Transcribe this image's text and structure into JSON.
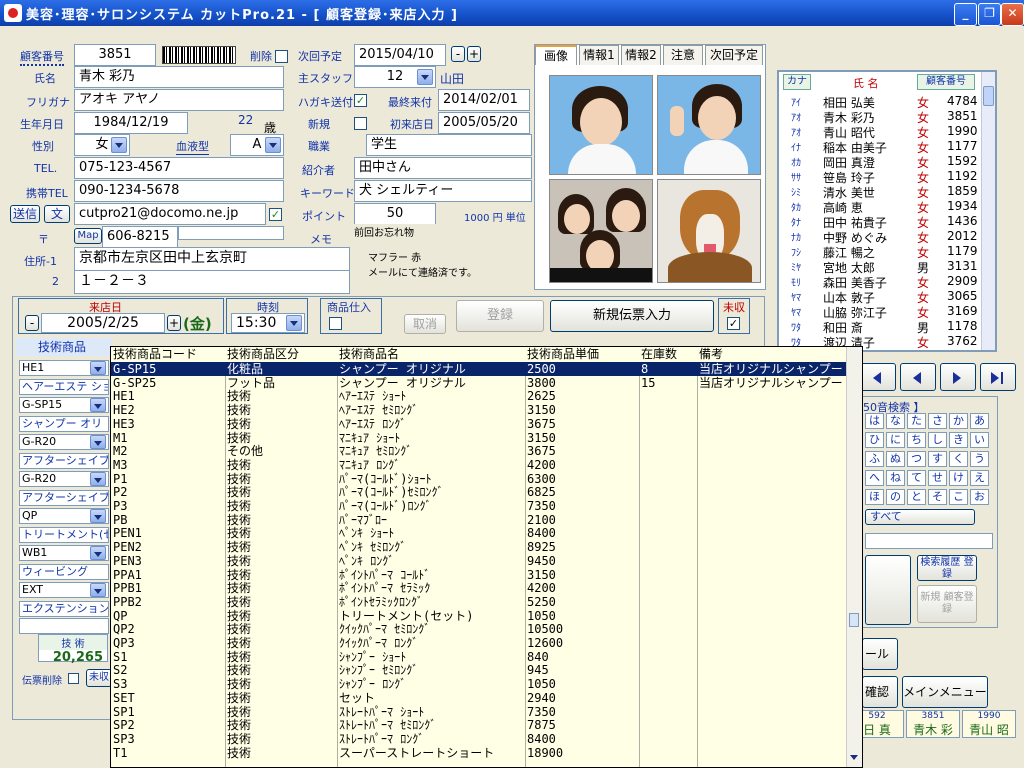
{
  "window": {
    "title": "美容･理容･サロンシステム カットPro.21 - [ 顧客登録･来店入力 ]"
  },
  "customer": {
    "no_label": "顧客番号",
    "no": "3851",
    "delete_label": "削除",
    "name_label": "氏名",
    "name": "青木 彩乃",
    "furigana_label": "フリガナ",
    "furigana": "アオキ アヤノ",
    "birth_label": "生年月日",
    "birth": "1984/12/19",
    "age": "22",
    "age_unit": "歳",
    "sex_label": "性別",
    "sex": "女",
    "blood_label": "血液型",
    "blood": "A",
    "tel_label": "TEL.",
    "tel": "075-123-4567",
    "mobile_label": "携帯TEL",
    "mobile": "090-1234-5678",
    "send_label": "送信",
    "text_label": "文",
    "email": "cutpro21@docomo.ne.jp",
    "zip_label": "〒",
    "map_label": "Map",
    "zip": "606-8215",
    "addr1_label": "住所-1",
    "addr1": "京都市左京区田中上玄京町",
    "addr2_label": "2",
    "addr2": "１－２－３",
    "next_label": "次回予定",
    "next": "2015/04/10",
    "staff_label": "主スタッフ",
    "staff_no": "12",
    "staff_name": "山田",
    "postcard_label": "ハガキ送付",
    "last_visit_label": "最終来付",
    "last_visit": "2014/02/01",
    "new_label": "新規",
    "first_visit_label": "初来店日",
    "first_visit": "2005/05/20",
    "job_label": "職業",
    "job": "学生",
    "referrer_label": "紹介者",
    "referrer": "田中さん",
    "keyword_label": "キーワード",
    "keyword": "犬 シェルティー",
    "point_label": "ポイント",
    "point": "50",
    "point_unit": "1000 円 単位",
    "memo_label": "メモ",
    "memo_title": "前回お忘れ物",
    "memo_line1": "マフラー 赤",
    "memo_line2": "メールにて連絡済です。"
  },
  "tabs": [
    "画像",
    "情報1",
    "情報2",
    "注意",
    "次回予定"
  ],
  "custlist": {
    "header_kana": "カナ",
    "header_name": "氏 名",
    "header_no": "顧客番号",
    "rows": [
      [
        "ｱｲ",
        "相田 弘美",
        "女",
        "4784"
      ],
      [
        "ｱｵ",
        "青木 彩乃",
        "女",
        "3851"
      ],
      [
        "ｱｵ",
        "青山 昭代",
        "女",
        "1990"
      ],
      [
        "ｲﾅ",
        "稲本 由美子",
        "女",
        "1177"
      ],
      [
        "ｵｶ",
        "岡田 真澄",
        "女",
        "1592"
      ],
      [
        "ｻｻ",
        "笹島 玲子",
        "女",
        "1192"
      ],
      [
        "ｼﾐ",
        "清水 美世",
        "女",
        "1859"
      ],
      [
        "ﾀｶ",
        "高崎 恵",
        "女",
        "1934"
      ],
      [
        "ﾀﾅ",
        "田中 祐貴子",
        "女",
        "1436"
      ],
      [
        "ﾅｶ",
        "中野 めぐみ",
        "女",
        "2012"
      ],
      [
        "ﾌｼ",
        "藤江 暢之",
        "女",
        "1179"
      ],
      [
        "ﾐﾔ",
        "宮地 太郎",
        "男",
        "3131"
      ],
      [
        "ﾓﾘ",
        "森田 美香子",
        "女",
        "2909"
      ],
      [
        "ﾔﾏ",
        "山本 敦子",
        "女",
        "3065"
      ],
      [
        "ﾔﾏ",
        "山脇 弥江子",
        "女",
        "3169"
      ],
      [
        "ﾜﾀ",
        "和田 斎",
        "男",
        "1178"
      ],
      [
        "ﾜﾀ",
        "渡辺 清子",
        "女",
        "3762"
      ]
    ]
  },
  "visit": {
    "date_label": "来店日",
    "date": "2005/2/25",
    "weekday": "(金)",
    "time_label": "時刻",
    "time": "15:30",
    "goods_label": "商品仕入",
    "cancel_label": "取消",
    "register_label": "登録",
    "new_slip_label": "新規伝票入力",
    "unpaid_label": "未収",
    "tech_header": "技術商品",
    "tech_total_label": "技 術",
    "tech_total": "20,265",
    "slip_delete_label": "伝票削除",
    "unpaid_btn": "未収"
  },
  "techlist": [
    "HE1",
    "ヘアーエステ ショート",
    "G-SP15",
    "シャンプー オリ",
    "G-R20",
    "アフターシェイブ",
    "G-R20",
    "アフターシェイブ",
    "QP",
    "トリートメント(セ",
    "WB1",
    "ウィービング",
    "EXT",
    "エクステンション"
  ],
  "kana_search": {
    "title": "50音検索 】",
    "chars": [
      [
        "は",
        "な",
        "た",
        "さ",
        "か",
        "あ"
      ],
      [
        "ひ",
        "に",
        "ち",
        "し",
        "き",
        "い"
      ],
      [
        "ふ",
        "ぬ",
        "つ",
        "す",
        "く",
        "う"
      ],
      [
        "へ",
        "ね",
        "て",
        "せ",
        "け",
        "え"
      ],
      [
        "ほ",
        "の",
        "と",
        "そ",
        "こ",
        "お"
      ]
    ],
    "all_label": "すべて",
    "history_label": "検索履歴 登録",
    "new_customer_label": "新規 顧客登録",
    "mail_label": "ール",
    "confirm_label": "確認",
    "main_menu_label": "メインメニュー"
  },
  "mini_cards": [
    [
      "592",
      "日 真"
    ],
    [
      "3851",
      "青木 彩"
    ],
    [
      "1990",
      "青山 昭"
    ]
  ],
  "dropdown": {
    "headers": [
      "技術商品コード",
      "技術商品区分",
      "技術商品名",
      "技術商品単価",
      "在庫数",
      "備考"
    ],
    "rows": [
      [
        "G-SP15",
        "化粧品",
        "シャンプー オリジナル",
        "2500",
        "8",
        "当店オリジナルシャンプー"
      ],
      [
        "G-SP25",
        "フット品",
        "シャンプー オリジナル",
        "3800",
        "15",
        "当店オリジナルシャンプー"
      ],
      [
        "HE1",
        "技術",
        "ﾍｱｰｴｽﾃ ｼｮｰﾄ",
        "2625",
        "",
        ""
      ],
      [
        "HE2",
        "技術",
        "ﾍｱｰｴｽﾃ ｾﾐﾛﾝｸﾞ",
        "3150",
        "",
        ""
      ],
      [
        "HE3",
        "技術",
        "ﾍｱｰｴｽﾃ ﾛﾝｸﾞ",
        "3675",
        "",
        ""
      ],
      [
        "M1",
        "技術",
        "ﾏﾆｷｭｱ ｼｮｰﾄ",
        "3150",
        "",
        ""
      ],
      [
        "M2",
        "その他",
        "ﾏﾆｷｭｱ ｾﾐﾛﾝｸﾞ",
        "3675",
        "",
        ""
      ],
      [
        "M3",
        "技術",
        "ﾏﾆｷｭｱ ﾛﾝｸﾞ",
        "4200",
        "",
        ""
      ],
      [
        "P1",
        "技術",
        "ﾊﾟｰﾏ(ｺｰﾙﾄﾞ)ｼｮｰﾄ",
        "6300",
        "",
        ""
      ],
      [
        "P2",
        "技術",
        "ﾊﾟｰﾏ(ｺｰﾙﾄﾞ)ｾﾐﾛﾝｸﾞ",
        "6825",
        "",
        ""
      ],
      [
        "P3",
        "技術",
        "ﾊﾟｰﾏ(ｺｰﾙﾄﾞ)ﾛﾝｸﾞ",
        "7350",
        "",
        ""
      ],
      [
        "PB",
        "技術",
        "ﾊﾟｰﾏﾌﾞﾛｰ",
        "2100",
        "",
        ""
      ],
      [
        "PEN1",
        "技術",
        "ﾍﾟﾝｷ ｼｮｰﾄ",
        "8400",
        "",
        ""
      ],
      [
        "PEN2",
        "技術",
        "ﾍﾟﾝｷ ｾﾐﾛﾝｸﾞ",
        "8925",
        "",
        ""
      ],
      [
        "PEN3",
        "技術",
        "ﾍﾟﾝｷ ﾛﾝｸﾞ",
        "9450",
        "",
        ""
      ],
      [
        "PPA1",
        "技術",
        "ﾎﾟｲﾝﾄﾊﾟｰﾏ ｺｰﾙﾄﾞ",
        "3150",
        "",
        ""
      ],
      [
        "PPB1",
        "技術",
        "ﾎﾟｲﾝﾄﾊﾟｰﾏ ｾﾗﾐｯｸ",
        "4200",
        "",
        ""
      ],
      [
        "PPB2",
        "技術",
        "ﾎﾟｲﾝﾄｾﾗﾐｯｸﾛﾝｸﾞ",
        "5250",
        "",
        ""
      ],
      [
        "QP",
        "技術",
        "トリートメント(セット)",
        "1050",
        "",
        ""
      ],
      [
        "QP2",
        "技術",
        "ｸｲｯｸﾊﾟｰﾏ ｾﾐﾛﾝｸﾞ",
        "10500",
        "",
        ""
      ],
      [
        "QP3",
        "技術",
        "ｸｲｯｸﾊﾟｰﾏ ﾛﾝｸﾞ",
        "12600",
        "",
        ""
      ],
      [
        "S1",
        "技術",
        "ｼｬﾝﾌﾟｰ ｼｮｰﾄ",
        "840",
        "",
        ""
      ],
      [
        "S2",
        "技術",
        "ｼｬﾝﾌﾟｰ ｾﾐﾛﾝｸﾞ",
        "945",
        "",
        ""
      ],
      [
        "S3",
        "技術",
        "ｼｬﾝﾌﾟｰ ﾛﾝｸﾞ",
        "1050",
        "",
        ""
      ],
      [
        "SET",
        "技術",
        "セット",
        "2940",
        "",
        ""
      ],
      [
        "SP1",
        "技術",
        "ｽﾄﾚｰﾄﾊﾟｰﾏ ｼｮｰﾄ",
        "7350",
        "",
        ""
      ],
      [
        "SP2",
        "技術",
        "ｽﾄﾚｰﾄﾊﾟｰﾏ ｾﾐﾛﾝｸﾞ",
        "7875",
        "",
        ""
      ],
      [
        "SP3",
        "技術",
        "ｽﾄﾚｰﾄﾊﾟｰﾏ ﾛﾝｸﾞ",
        "8400",
        "",
        ""
      ],
      [
        "T1",
        "技術",
        "スーパーストレートショート",
        "18900",
        "",
        ""
      ]
    ]
  },
  "colors": {
    "title_bar": "#1450c8",
    "label_blue": "#1133aa",
    "female": "#c00000",
    "selected_row": "#0a246a",
    "dropdown_bg": "#ffffe6"
  }
}
